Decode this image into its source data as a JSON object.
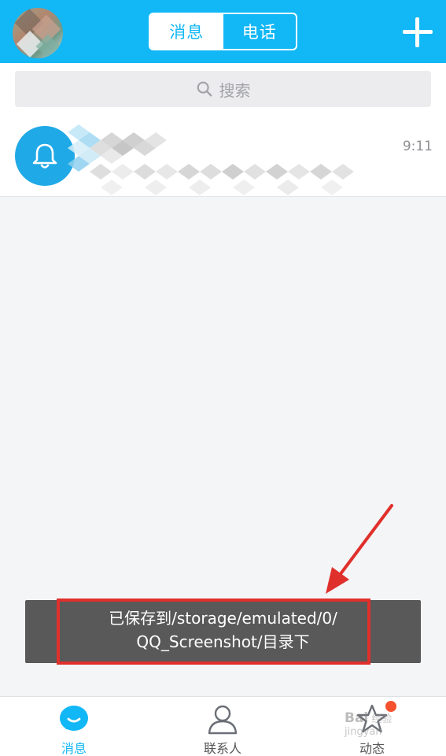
{
  "header": {
    "tabs": [
      {
        "label": "消息",
        "active": true
      },
      {
        "label": "电话",
        "active": false
      }
    ],
    "add_icon": "plus-icon"
  },
  "search": {
    "placeholder": "搜索",
    "icon": "search-icon"
  },
  "conversations": [
    {
      "avatar_icon": "bell-icon",
      "time": "9:11"
    }
  ],
  "toast": {
    "line1": "已保存到/storage/emulated/0/",
    "line2": "QQ_Screenshot/目录下"
  },
  "bottom_nav": [
    {
      "label": "消息",
      "icon": "message-bubble-icon",
      "active": true
    },
    {
      "label": "联系人",
      "icon": "contact-person-icon",
      "active": false
    },
    {
      "label": "动态",
      "icon": "star-icon",
      "active": false,
      "badge": "red-dot"
    }
  ],
  "watermark": {
    "brand": "Bai",
    "line1": "经验",
    "line2": "jingyan"
  },
  "colors": {
    "brand_blue": "#12b7f5",
    "toast_bg": "#595959",
    "highlight_red": "#e0302c",
    "badge_red": "#f4512f"
  }
}
